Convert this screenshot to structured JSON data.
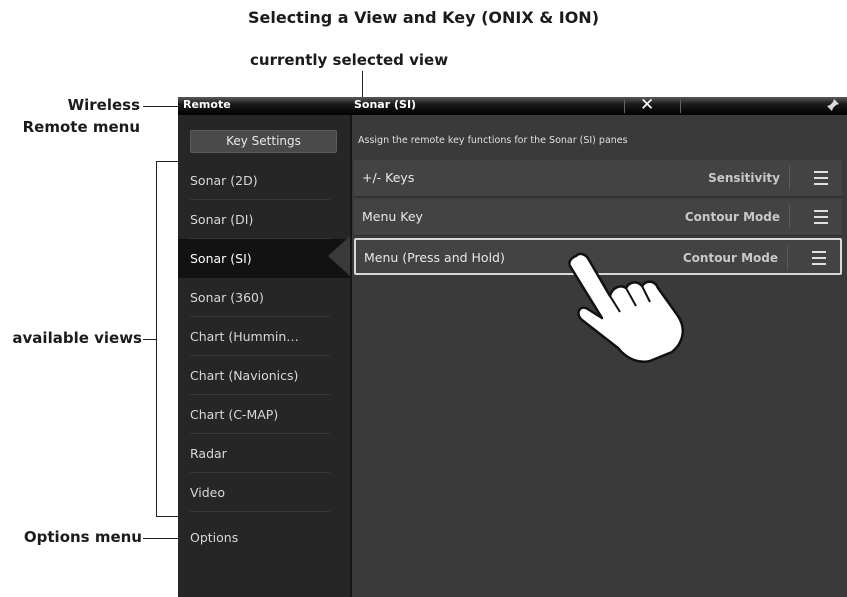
{
  "captions": {
    "title": "Selecting a View and Key (ONIX & ION)",
    "current_view": "currently selected view",
    "wireless_line1": "Wireless",
    "wireless_line2": "Remote menu",
    "available_views": "available views",
    "options_menu": "Options menu"
  },
  "topbar": {
    "remote_title": "Remote",
    "view_title": "Sonar (SI)",
    "close_glyph": "✕"
  },
  "sidebar": {
    "key_settings": "Key Settings",
    "items": [
      {
        "label": "Sonar (2D)"
      },
      {
        "label": "Sonar (DI)"
      },
      {
        "label": "Sonar (SI)",
        "selected": true
      },
      {
        "label": "Sonar (360)"
      },
      {
        "label": "Chart (Hummin…"
      },
      {
        "label": "Chart (Navionics)"
      },
      {
        "label": "Chart (C-MAP)"
      },
      {
        "label": "Radar"
      },
      {
        "label": "Video"
      },
      {
        "label": "Options"
      }
    ]
  },
  "main": {
    "description": "Assign the remote key functions for the Sonar (SI) panes",
    "keys": [
      {
        "name": "+/- Keys",
        "value": "Sensitivity"
      },
      {
        "name": "Menu Key",
        "value": "Contour Mode"
      },
      {
        "name": "Menu (Press and Hold)",
        "value": "Contour Mode",
        "selected": true
      }
    ]
  },
  "icons": {
    "close": "close-icon",
    "pin": "pin-icon",
    "menu": "menu-icon",
    "hand": "pointing-hand-icon"
  }
}
